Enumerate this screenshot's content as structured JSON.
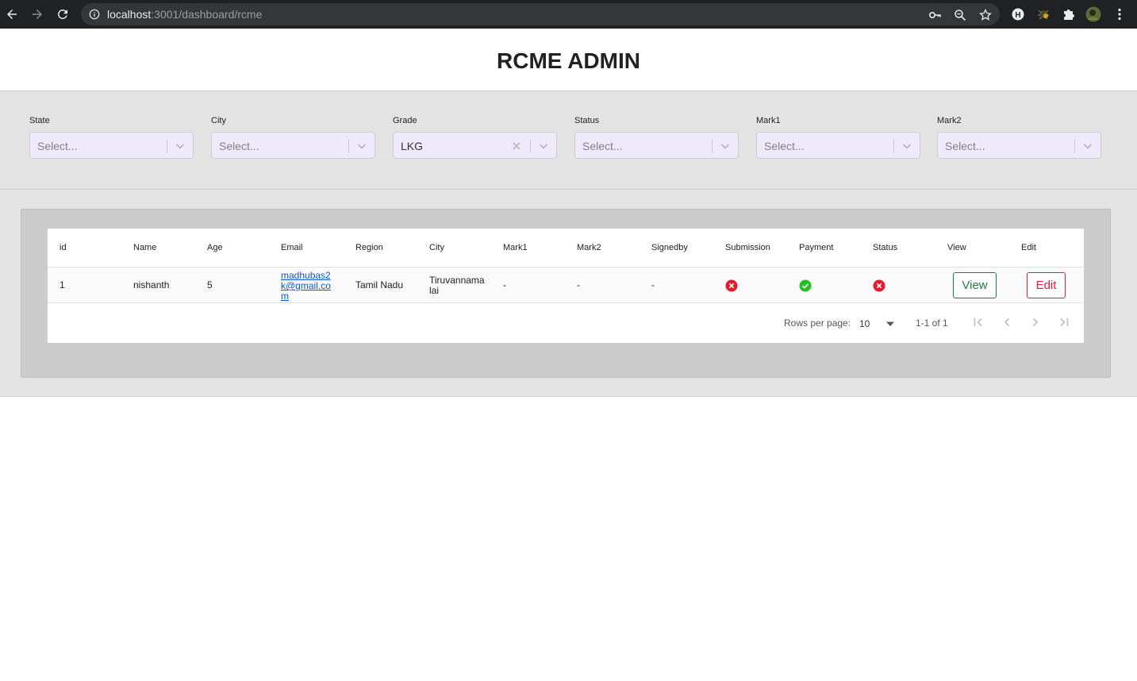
{
  "browser": {
    "url_host": "localhost",
    "url_path": ":3001/dashboard/rcme",
    "icons": [
      "back-icon",
      "forward-icon",
      "reload-icon",
      "info-icon",
      "key-icon",
      "zoom-icon",
      "star-icon",
      "extension-h-icon",
      "extension-bug-icon",
      "puzzle-icon",
      "profile-avatar",
      "menu-icon"
    ]
  },
  "header": {
    "title": "RCME ADMIN"
  },
  "filters": [
    {
      "label": "State",
      "value": "Select...",
      "filled": false
    },
    {
      "label": "City",
      "value": "Select...",
      "filled": false
    },
    {
      "label": "Grade",
      "value": "LKG",
      "filled": true
    },
    {
      "label": "Status",
      "value": "Select...",
      "filled": false
    },
    {
      "label": "Mark1",
      "value": "Select...",
      "filled": false
    },
    {
      "label": "Mark2",
      "value": "Select...",
      "filled": false
    }
  ],
  "table": {
    "columns": [
      "id",
      "Name",
      "Age",
      "Email",
      "Region",
      "City",
      "Mark1",
      "Mark2",
      "Signedby",
      "Submission",
      "Payment",
      "Status",
      "View",
      "Edit"
    ],
    "rows": [
      {
        "id": "1",
        "name": "nishanth",
        "age": "5",
        "email": "madhubas2k@gmail.com",
        "region": "Tamil Nadu",
        "city": "Tiruvannamalai",
        "mark1": "-",
        "mark2": "-",
        "signedby": "-",
        "submission": "error",
        "payment": "success",
        "status": "error",
        "view_label": "View",
        "edit_label": "Edit"
      }
    ],
    "pagination": {
      "rows_per_page_label": "Rows per page:",
      "rows_per_page": "10",
      "range": "1-1 of 1"
    }
  },
  "colors": {
    "success": "#1fc21f",
    "error": "#e8192c",
    "view_button": "#1a7f45",
    "edit_button": "#d6223a",
    "select_bg": "#eeeafc",
    "link": "#0b57d0"
  }
}
